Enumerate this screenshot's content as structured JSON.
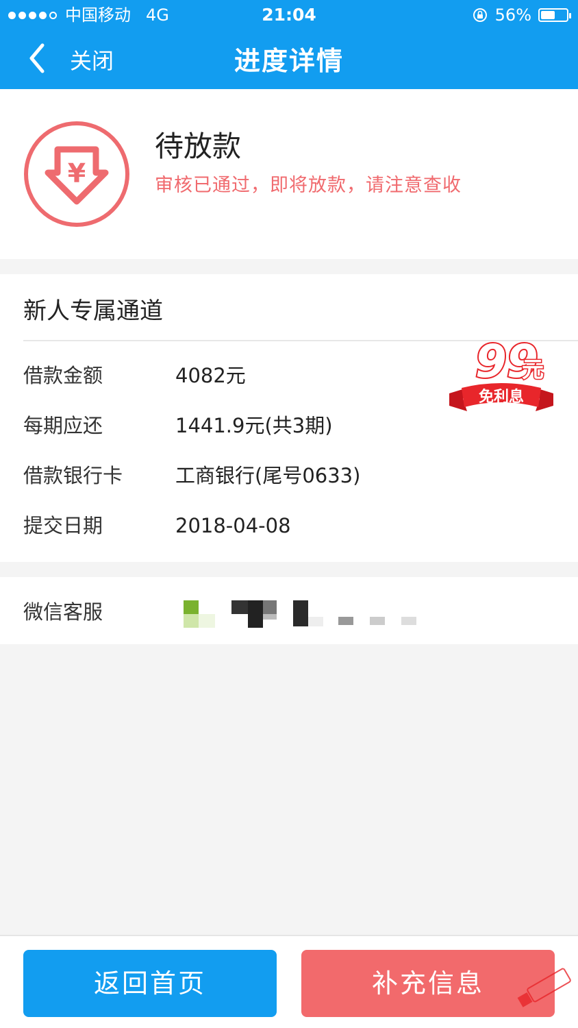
{
  "status_bar": {
    "carrier": "中国移动",
    "network": "4G",
    "time": "21:04",
    "battery": "56%",
    "battery_level": 0.56
  },
  "nav": {
    "back_icon": "chevron-left-icon",
    "close_label": "关闭",
    "title": "进度详情"
  },
  "status": {
    "icon": "yen-down-arrow-icon",
    "title": "待放款",
    "subtitle": "审核已通过，即将放款，请注意查收"
  },
  "detail": {
    "heading": "新人专属通道",
    "badge": {
      "number": "99",
      "unit": "元",
      "text": "免利息"
    },
    "rows": [
      {
        "label": "借款金额",
        "value": "4082元"
      },
      {
        "label": "每期应还",
        "value": "1441.9元(共3期)"
      },
      {
        "label": "借款银行卡",
        "value": "工商银行(尾号0633)"
      },
      {
        "label": "提交日期",
        "value": "2018-04-08"
      }
    ]
  },
  "wechat": {
    "label": "微信客服"
  },
  "buttons": {
    "home": "返回首页",
    "supplement": "补充信息"
  },
  "colors": {
    "brand_blue": "#129df0",
    "accent_red": "#f06a6e"
  }
}
